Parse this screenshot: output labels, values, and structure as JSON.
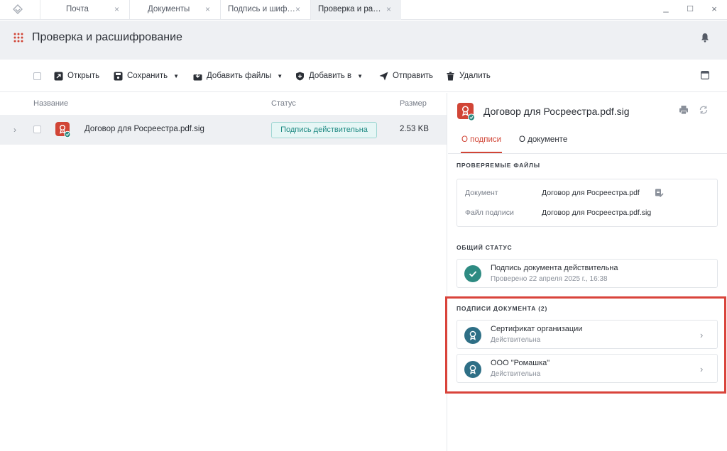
{
  "tabs": [
    {
      "label": "Почта"
    },
    {
      "label": "Документы"
    },
    {
      "label": "Подпись и шиф…"
    },
    {
      "label": "Проверка и ра…"
    }
  ],
  "tab_close_glyph": "×",
  "window_controls": {
    "minimize": "_",
    "maximize": "☐",
    "close": "×"
  },
  "header": {
    "title": "Проверка и расшифрование"
  },
  "toolbar": {
    "open": "Открыть",
    "save": "Сохранить",
    "add_files": "Добавить файлы",
    "add_to": "Добавить в",
    "send": "Отправить",
    "delete": "Удалить"
  },
  "list": {
    "columns": {
      "name": "Название",
      "status": "Статус",
      "size": "Размер"
    },
    "rows": [
      {
        "name": "Договор для Росреестра.pdf.sig",
        "status": "Подпись действительна",
        "size": "2.53 KB"
      }
    ]
  },
  "panel": {
    "title": "Договор для Росреестра.pdf.sig",
    "tabs": {
      "signature": "О подписи",
      "document": "О документе"
    },
    "files_section": {
      "heading": "ПРОВЕРЯЕМЫЕ ФАЙЛЫ",
      "document_label": "Документ",
      "document_value": "Договор для Росреестра.pdf",
      "signature_label": "Файл подписи",
      "signature_value": "Договор для Росреестра.pdf.sig"
    },
    "status_section": {
      "heading": "ОБЩИЙ СТАТУС",
      "main": "Подпись документа действительна",
      "sub": "Проверено 22 апреля 2025 г., 16:38"
    },
    "signatures_section": {
      "heading": "ПОДПИСИ ДОКУМЕНТА (2)",
      "items": [
        {
          "name": "Сертификат организации",
          "status": "Действительна"
        },
        {
          "name": "ООО \"Ромашка\"",
          "status": "Действительна"
        }
      ]
    }
  },
  "colors": {
    "accent": "#d14536",
    "valid": "#1f8a83",
    "highlight": "#d9443b"
  }
}
